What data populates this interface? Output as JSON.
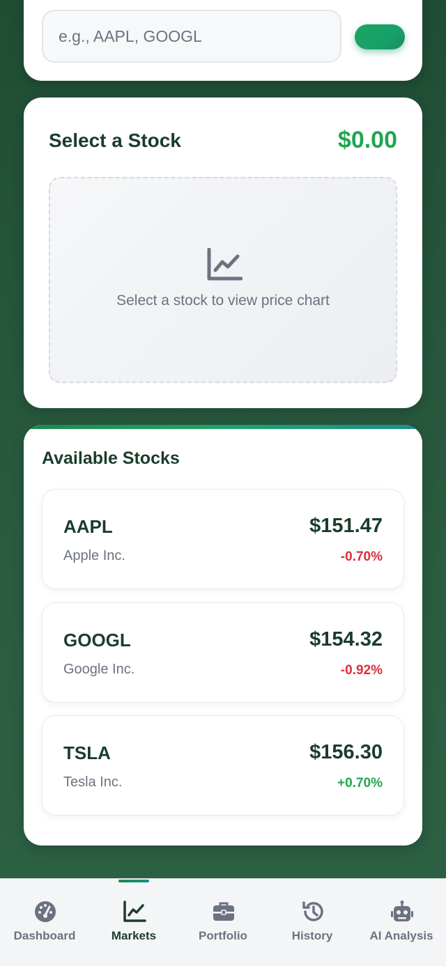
{
  "search": {
    "placeholder": "e.g., AAPL, GOOGL",
    "button_color": "#1fa35c"
  },
  "chart_panel": {
    "title": "Select a Stock",
    "price": "$0.00",
    "placeholder_text": "Select a stock to view price chart",
    "icon": "line-chart-icon"
  },
  "stocks": {
    "title": "Available Stocks",
    "items": [
      {
        "symbol": "AAPL",
        "name": "Apple Inc.",
        "price": "$151.47",
        "change": "-0.70%",
        "direction": "down"
      },
      {
        "symbol": "GOOGL",
        "name": "Google Inc.",
        "price": "$154.32",
        "change": "-0.92%",
        "direction": "down"
      },
      {
        "symbol": "TSLA",
        "name": "Tesla Inc.",
        "price": "$156.30",
        "change": "+0.70%",
        "direction": "up"
      }
    ]
  },
  "nav": {
    "items": [
      {
        "label": "Dashboard",
        "icon": "gauge-icon",
        "active": false
      },
      {
        "label": "Markets",
        "icon": "line-chart-icon",
        "active": true
      },
      {
        "label": "Portfolio",
        "icon": "briefcase-icon",
        "active": false
      },
      {
        "label": "History",
        "icon": "history-icon",
        "active": false
      },
      {
        "label": "AI Analysis",
        "icon": "robot-icon",
        "active": false
      }
    ]
  },
  "colors": {
    "background": "#2a5c40",
    "accent_green": "#22a552",
    "negative_red": "#dc2f3e",
    "heading": "#1b3d2b",
    "muted": "#6b7280"
  }
}
